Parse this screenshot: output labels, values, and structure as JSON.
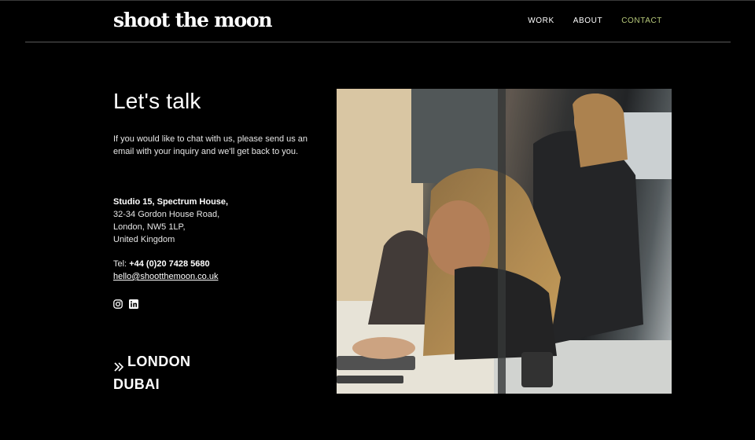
{
  "header": {
    "logo": "shoot the moon",
    "nav": [
      {
        "label": "WORK",
        "active": false
      },
      {
        "label": "ABOUT",
        "active": false
      },
      {
        "label": "CONTACT",
        "active": true
      }
    ]
  },
  "contact": {
    "heading": "Let's talk",
    "intro": "If you would like to chat with us, please send us an email with your inquiry and we'll get back to you.",
    "address": {
      "line1": "Studio 15, Spectrum House,",
      "line2": "32-34 Gordon House Road,",
      "line3": "London, NW5 1LP,",
      "line4": "United Kingdom"
    },
    "phone_label": "Tel:",
    "phone_number": "+44 (0)20 7428 5680",
    "email": "hello@shootthemoon.co.uk",
    "socials": [
      "instagram-icon",
      "linkedin-icon"
    ],
    "locations": [
      "LONDON",
      "DUBAI"
    ]
  },
  "colors": {
    "background": "#000000",
    "text": "#ffffff",
    "accent": "#b7c97a"
  }
}
